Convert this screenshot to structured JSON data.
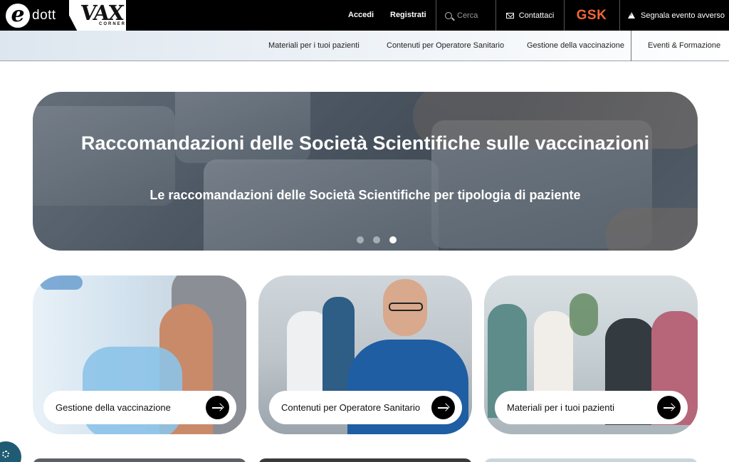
{
  "header": {
    "logo_text": "dott",
    "logo_letter": "e",
    "vax_text": "VAX",
    "vax_sub": "CORNER",
    "login_label": "Accedi",
    "register_label": "Registrati",
    "search_placeholder": "Cerca",
    "contact_label": "Contattaci",
    "brand": "GSK",
    "report_label": "Segnala evento avverso"
  },
  "subnav": {
    "items": [
      {
        "label": "Materiali per i tuoi pazienti"
      },
      {
        "label": "Contenuti per Operatore Sanitario"
      },
      {
        "label": "Gestione della vaccinazione"
      },
      {
        "label": "Eventi & Formazione"
      }
    ]
  },
  "hero": {
    "title": "Raccomandazioni delle Società Scientifiche sulle vaccinazioni",
    "subtitle": "Le raccomandazioni delle Società Scientifiche per tipologia di paziente",
    "slides": 3,
    "active_slide": 3
  },
  "cards": [
    {
      "label": "Gestione della vaccinazione",
      "icon": "arrow-right-icon"
    },
    {
      "label": "Contenuti per Operatore Sanitario",
      "icon": "arrow-right-icon"
    },
    {
      "label": "Materiali per i tuoi pazienti",
      "icon": "arrow-right-icon"
    }
  ],
  "colors": {
    "accent": "#f36633",
    "topbar": "#000000",
    "cookie": "#1f5c73"
  }
}
